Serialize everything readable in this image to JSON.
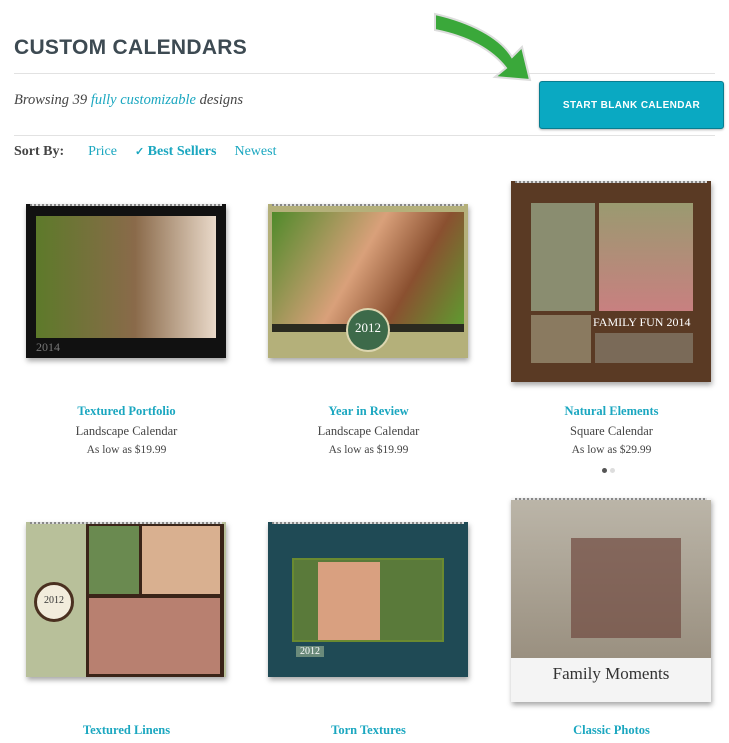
{
  "header": {
    "title": "CUSTOM CALENDARS",
    "browse_prefix": "Browsing 39 ",
    "browse_highlight": "fully customizable",
    "browse_suffix": " designs",
    "start_button": "START BLANK CALENDAR"
  },
  "sort": {
    "label": "Sort By:",
    "options": [
      {
        "label": "Price"
      },
      {
        "label": "Best Sellers",
        "selected": true
      },
      {
        "label": "Newest"
      }
    ]
  },
  "accent": "#0aa9c2",
  "products": [
    {
      "name": "Textured Portfolio",
      "type": "Landscape Calendar",
      "price": "As low as $19.99",
      "cover_text": "2014"
    },
    {
      "name": "Year in Review",
      "type": "Landscape Calendar",
      "price": "As low as $19.99",
      "cover_text": "2012"
    },
    {
      "name": "Natural Elements",
      "type": "Square Calendar",
      "price": "As low as $29.99",
      "cover_text": "FAMILY FUN 2014"
    },
    {
      "name": "Textured Linens",
      "cover_text": "2012"
    },
    {
      "name": "Torn Textures",
      "cover_text": "2012"
    },
    {
      "name": "Classic Photos",
      "cover_text": "Family Moments"
    }
  ],
  "carousel": {
    "pages": 2,
    "current": 1
  }
}
